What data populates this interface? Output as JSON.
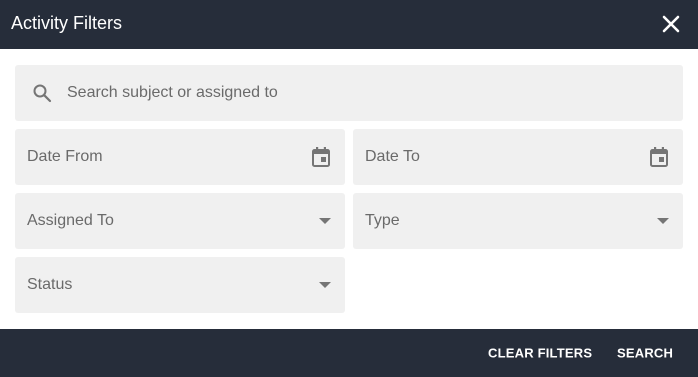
{
  "dialog": {
    "title": "Activity Filters",
    "close_icon": "close-icon"
  },
  "search": {
    "placeholder": "Search subject or assigned to",
    "icon": "search-icon"
  },
  "fields": {
    "date_from": {
      "label": "Date From",
      "icon": "calendar-icon"
    },
    "date_to": {
      "label": "Date To",
      "icon": "calendar-icon"
    },
    "assigned_to": {
      "label": "Assigned To",
      "icon": "dropdown-arrow-icon"
    },
    "type": {
      "label": "Type",
      "icon": "dropdown-arrow-icon"
    },
    "status": {
      "label": "Status",
      "icon": "dropdown-arrow-icon"
    }
  },
  "footer": {
    "clear_label": "CLEAR FILTERS",
    "search_label": "SEARCH"
  },
  "colors": {
    "header_bg": "#262d3a",
    "field_bg": "#f0f0f0",
    "label_text": "#6a6a6a",
    "icon": "#757575"
  }
}
